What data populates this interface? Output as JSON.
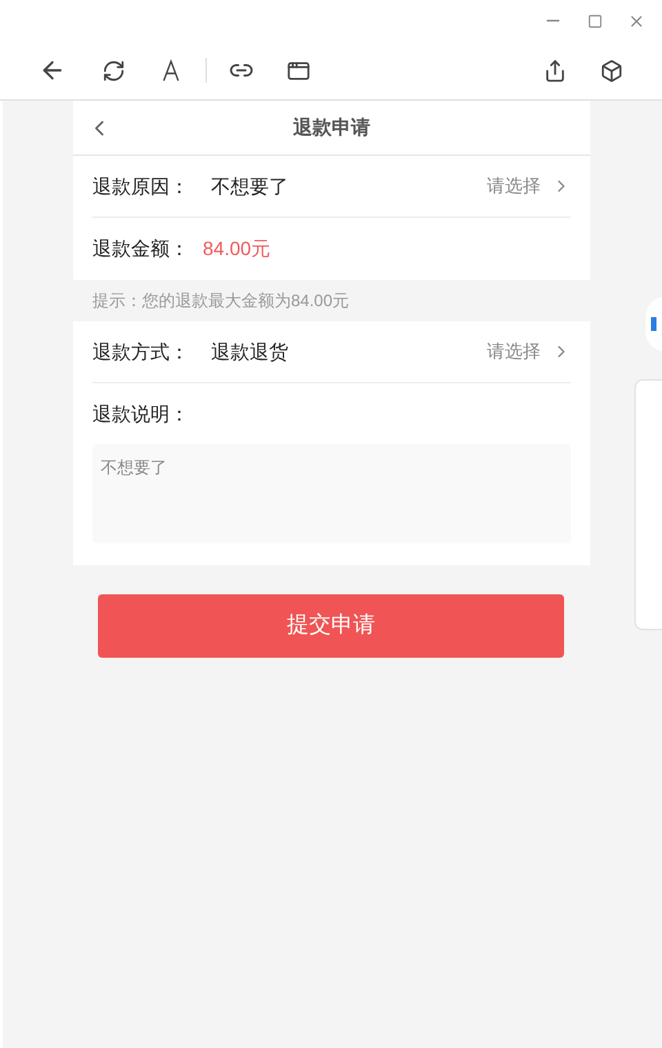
{
  "page_title": "退款申请",
  "rows_top": [
    {
      "kind": "select",
      "label": "退款原因：",
      "value": "不想要了",
      "action": "请选择"
    },
    {
      "kind": "amount",
      "label": "退款金额：",
      "value": "84.00元"
    }
  ],
  "hint": "提示：您的退款最大金额为84.00元",
  "rows_bottom": [
    {
      "kind": "select",
      "label": "退款方式：",
      "value": "退款退货",
      "action": "请选择"
    }
  ],
  "description": {
    "label": "退款说明：",
    "placeholder": "不想要了"
  },
  "submit_button": "提交申请"
}
